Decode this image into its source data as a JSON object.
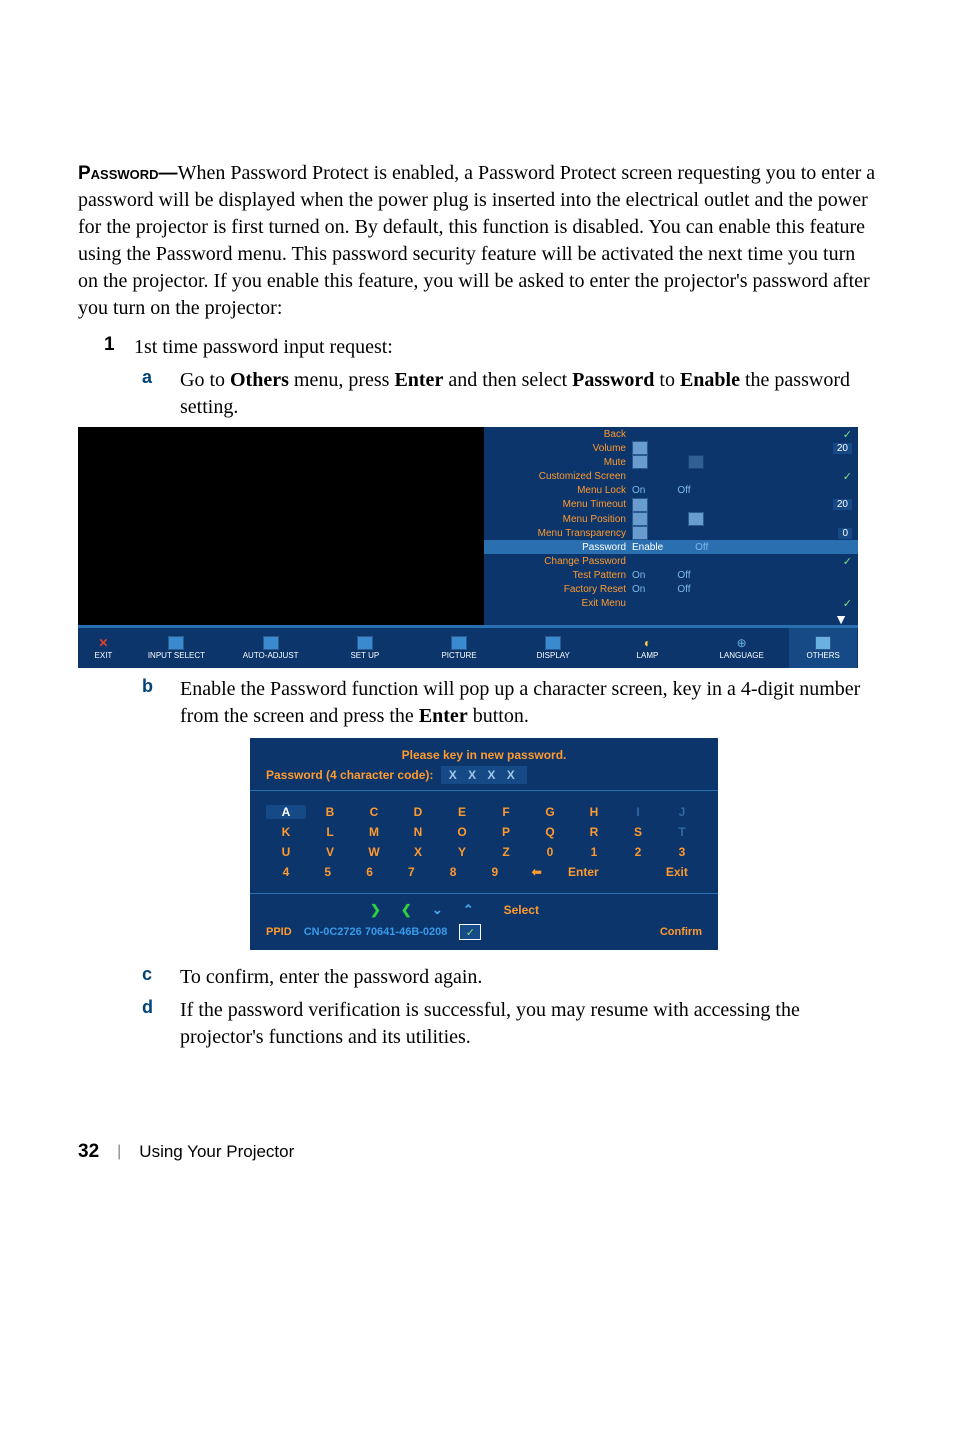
{
  "intro": {
    "heading_label": "Password—",
    "text": "When Password Protect is enabled, a Password Protect screen requesting you to enter a password will be displayed when the power plug is inserted into the electrical outlet and the power for the projector is first turned on. By default, this function is disabled. You can enable this feature using the Password menu. This password security feature will be activated the next time you turn on the projector. If you enable this feature, you will be asked to enter the projector's password after you turn on the projector:"
  },
  "step1": {
    "num": "1",
    "text": "1st time password input request:"
  },
  "sub_a": {
    "letter": "a",
    "pre": "Go to ",
    "b1": "Others",
    "mid1": " menu, press ",
    "b2": "Enter",
    "mid2": " and then select ",
    "b3": "Password",
    "mid3": " to ",
    "b4": "Enable",
    "post": " the password setting."
  },
  "osd1": {
    "rows": [
      {
        "label": "Back",
        "type": "check"
      },
      {
        "label": "Volume",
        "type": "slider-icon",
        "value": "20"
      },
      {
        "label": "Mute",
        "type": "two-icons"
      },
      {
        "label": "Customized Screen",
        "type": "check"
      },
      {
        "label": "Menu Lock",
        "type": "onoff",
        "on": "On",
        "off": "Off"
      },
      {
        "label": "Menu Timeout",
        "type": "slider-icon",
        "value": "20"
      },
      {
        "label": "Menu Position",
        "type": "two-icons"
      },
      {
        "label": "Menu Transparency",
        "type": "slider-icon",
        "value": "0"
      },
      {
        "label": "Password",
        "type": "onoff-hl",
        "on": "Enable",
        "off": "Off"
      },
      {
        "label": "Change Password",
        "type": "check"
      },
      {
        "label": "Test Pattern",
        "type": "onoff",
        "on": "On",
        "off": "Off"
      },
      {
        "label": "Factory Reset",
        "type": "onoff",
        "on": "On",
        "off": "Off"
      },
      {
        "label": "Exit Menu",
        "type": "check"
      }
    ],
    "footer": [
      "EXIT",
      "INPUT SELECT",
      "AUTO-ADJUST",
      "SET UP",
      "PICTURE",
      "DISPLAY",
      "LAMP",
      "LANGUAGE",
      "OTHERS"
    ]
  },
  "sub_b": {
    "letter": "b",
    "pre": "Enable the Password function will pop up a character screen, key in a 4-digit number from the screen and press the ",
    "b1": "Enter",
    "post": " button."
  },
  "osd2": {
    "title": "Please key in new password.",
    "sub_label": "Password (4 character code):",
    "sub_mask": "X X X X",
    "rows": [
      [
        "A",
        "B",
        "C",
        "D",
        "E",
        "F",
        "G",
        "H",
        "I",
        "J"
      ],
      [
        "K",
        "L",
        "M",
        "N",
        "O",
        "P",
        "Q",
        "R",
        "S",
        "T"
      ],
      [
        "U",
        "V",
        "W",
        "X",
        "Y",
        "Z",
        "0",
        "1",
        "2",
        "3"
      ],
      [
        "4",
        "5",
        "6",
        "7",
        "8",
        "9",
        "⬅",
        "Enter",
        "",
        "Exit"
      ]
    ],
    "select_label": "Select",
    "ppid_label": "PPID",
    "ppid_value": "CN-0C2726 70641-46B-0208",
    "confirm_label": "Confirm"
  },
  "sub_c": {
    "letter": "c",
    "text": "To confirm, enter the password again."
  },
  "sub_d": {
    "letter": "d",
    "text": "If the password verification is successful, you may resume with accessing the projector's functions and its utilities."
  },
  "footer": {
    "page": "32",
    "section": "Using Your Projector"
  }
}
